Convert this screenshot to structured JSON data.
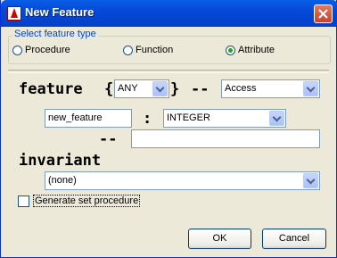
{
  "window": {
    "title": "New Feature"
  },
  "feature_type": {
    "group_label": "Select feature type",
    "options": [
      {
        "label": "Procedure",
        "checked": false
      },
      {
        "label": "Function",
        "checked": false
      },
      {
        "label": "Attribute",
        "checked": true
      }
    ]
  },
  "feature_line": {
    "keyword": "feature",
    "open_brace": "{",
    "export_value": "ANY",
    "close_brace": "}",
    "dashes": "--",
    "category_value": "Access"
  },
  "name_line": {
    "name_value": "new_feature",
    "colon": ":",
    "type_value": "INTEGER"
  },
  "comment_line": {
    "dashes": "--",
    "comment_value": ""
  },
  "invariant": {
    "keyword": "invariant",
    "value": "(none)"
  },
  "options": {
    "generate_set_procedure_label": "Generate set procedure",
    "generate_set_procedure_checked": false
  },
  "buttons": {
    "ok": "OK",
    "cancel": "Cancel"
  }
}
